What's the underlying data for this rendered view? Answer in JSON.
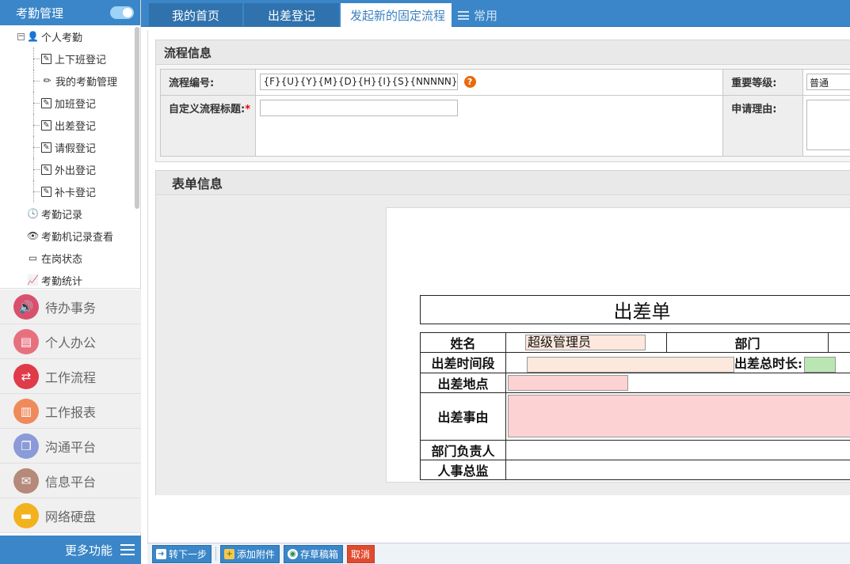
{
  "sidebar": {
    "title": "考勤管理",
    "tree": [
      {
        "label": "个人考勤",
        "icon": "person-icon"
      },
      {
        "label": "上下班登记",
        "icon": "edit-icon"
      },
      {
        "label": "我的考勤管理",
        "icon": "pencil-icon"
      },
      {
        "label": "加班登记",
        "icon": "edit-icon"
      },
      {
        "label": "出差登记",
        "icon": "edit-icon"
      },
      {
        "label": "请假登记",
        "icon": "edit-icon"
      },
      {
        "label": "外出登记",
        "icon": "edit-icon"
      },
      {
        "label": "补卡登记",
        "icon": "edit-icon"
      },
      {
        "label": "考勤记录",
        "icon": "clock-icon"
      },
      {
        "label": "考勤机记录查看",
        "icon": "eye-icon"
      },
      {
        "label": "在岗状态",
        "icon": "card-icon"
      },
      {
        "label": "考勤统计",
        "icon": "chart-icon"
      }
    ],
    "menu": [
      {
        "label": "待办事务",
        "icon": "speaker-icon",
        "color": "#d9506e"
      },
      {
        "label": "个人办公",
        "icon": "id-card-icon",
        "color": "#e7707f"
      },
      {
        "label": "工作流程",
        "icon": "swap-icon",
        "color": "#e03b48"
      },
      {
        "label": "工作报表",
        "icon": "bar-chart-icon",
        "color": "#ef8a5c"
      },
      {
        "label": "沟通平台",
        "icon": "chat-icon",
        "color": "#8a9bd8"
      },
      {
        "label": "信息平台",
        "icon": "mail-icon",
        "color": "#b58a7a"
      },
      {
        "label": "网络硬盘",
        "icon": "disk-icon",
        "color": "#f2b21e"
      }
    ],
    "more_label": "更多功能"
  },
  "tabs": {
    "home": "我的首页",
    "trip": "出差登记",
    "current": "发起新的固定流程",
    "common": "常用"
  },
  "flow_info": {
    "heading": "流程信息",
    "number_label": "流程编号:",
    "number_value": "{F}{U}{Y}{M}{D}{H}{I}{S}{NNNNN}",
    "help": "?",
    "title_label": "自定义流程标题:",
    "required_mark": "*",
    "level_label": "重要等级:",
    "level_value": "普通",
    "reason_label": "申请理由:"
  },
  "form_info": {
    "heading": "表单信息",
    "form_title": "出差单",
    "name_label": "姓名",
    "name_value": "超级管理员",
    "dept_label": "部门",
    "period_label": "出差时间段",
    "duration_label": "出差总时长:",
    "place_label": "出差地点",
    "reason_label": "出差事由",
    "head_label": "部门负责人",
    "hr_label": "人事总监"
  },
  "toolbar": {
    "next": "转下一步",
    "attach": "添加附件",
    "draft": "存草稿箱",
    "cancel": "取消"
  },
  "colors": {
    "primary": "#3a86c8",
    "peach_field": "#fde8dd",
    "pink_field": "#fdd2d2",
    "green_field": "#b9e6b2",
    "cancel": "#e04b2f"
  }
}
